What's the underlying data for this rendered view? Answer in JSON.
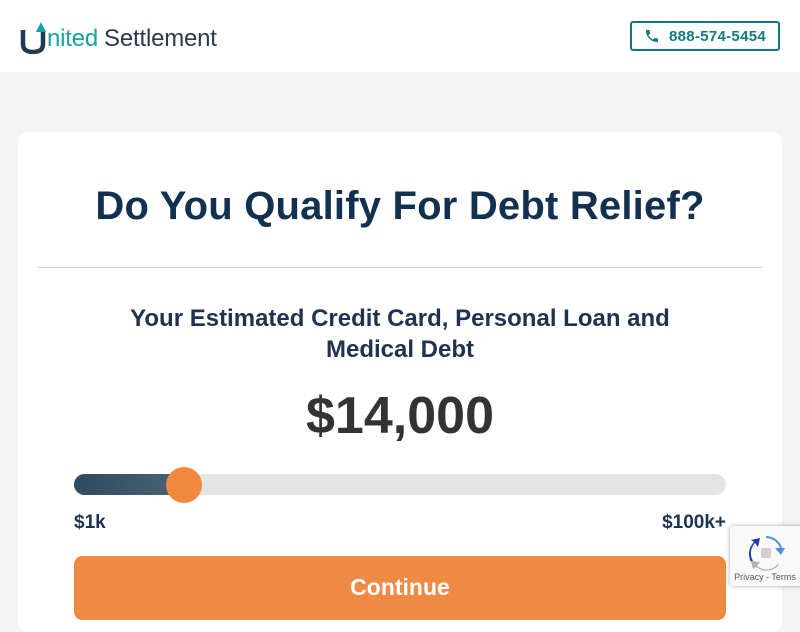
{
  "header": {
    "logo_u": "U",
    "logo_nited": "nited",
    "logo_settlement": "Settlement",
    "phone": "888-574-5454"
  },
  "main": {
    "headline": "Do You Qualify For Debt Relief?",
    "subheadline": "Your Estimated Credit Card, Personal Loan and Medical Debt",
    "amount": "$14,000",
    "slider": {
      "min_label": "$1k",
      "max_label": "$100k+",
      "value_fraction": 0.15
    },
    "continue_label": "Continue"
  },
  "recaptcha": {
    "links": "Privacy - Terms"
  },
  "colors": {
    "brand_teal": "#15a3a0",
    "heading_navy": "#12304f",
    "accent_orange": "#ef8a45",
    "slider_fill": "#2f4a5e"
  }
}
